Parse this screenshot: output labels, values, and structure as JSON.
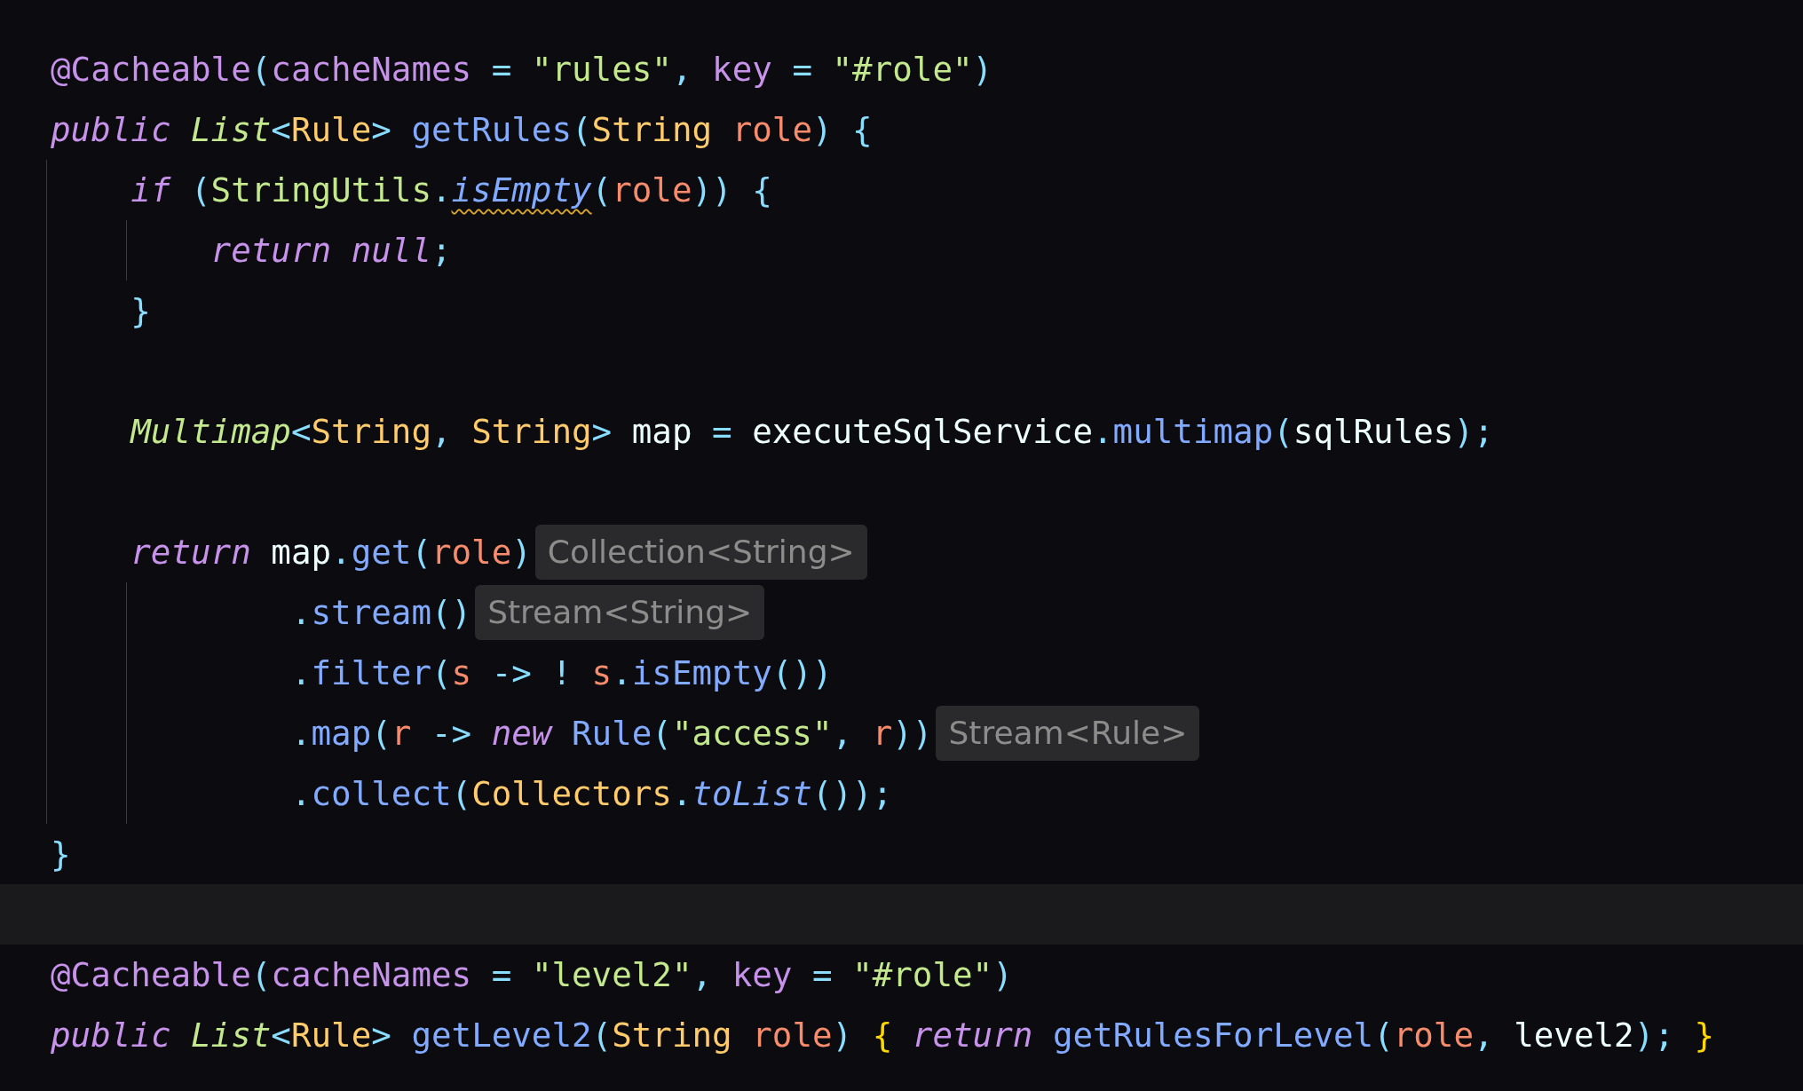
{
  "editor": {
    "lines": [
      {
        "current": false,
        "tokens": [
          {
            "text": "@Cacheable",
            "kind": "ann"
          },
          {
            "text": "(",
            "kind": "punc"
          },
          {
            "text": "cacheNames",
            "kind": "attr"
          },
          {
            "text": " = ",
            "kind": "op"
          },
          {
            "text": "\"rules\"",
            "kind": "str"
          },
          {
            "text": ", ",
            "kind": "op"
          },
          {
            "text": "key",
            "kind": "attr"
          },
          {
            "text": " = ",
            "kind": "op"
          },
          {
            "text": "\"#role\"",
            "kind": "str"
          },
          {
            "text": ")",
            "kind": "punc"
          }
        ]
      },
      {
        "current": false,
        "tokens": [
          {
            "text": "public ",
            "kind": "kw"
          },
          {
            "text": "List",
            "kind": "itype"
          },
          {
            "text": "<",
            "kind": "op"
          },
          {
            "text": "Rule",
            "kind": "type"
          },
          {
            "text": "> ",
            "kind": "op"
          },
          {
            "text": "getRules",
            "kind": "fn"
          },
          {
            "text": "(",
            "kind": "punc"
          },
          {
            "text": "String ",
            "kind": "type"
          },
          {
            "text": "role",
            "kind": "param"
          },
          {
            "text": ") {",
            "kind": "punc"
          }
        ],
        "kind": "block",
        "children": [
          {
            "current": false,
            "tokens": [
              {
                "text": "if ",
                "kind": "kw"
              },
              {
                "text": "(",
                "kind": "punc"
              },
              {
                "text": "StringUtils",
                "kind": "cls"
              },
              {
                "text": ".",
                "kind": "op"
              },
              {
                "text": "isEmpty",
                "kind": "warnfn"
              },
              {
                "text": "(",
                "kind": "punc"
              },
              {
                "text": "role",
                "kind": "param"
              },
              {
                "text": ")) {",
                "kind": "punc"
              }
            ],
            "kind": "block",
            "children": [
              {
                "current": false,
                "tokens": [
                  {
                    "text": "return null",
                    "kind": "kw"
                  },
                  {
                    "text": ";",
                    "kind": "op"
                  }
                ]
              }
            ]
          },
          {
            "current": false,
            "tokens": [
              {
                "text": "}",
                "kind": "punc"
              }
            ]
          },
          {
            "current": false
          },
          {
            "current": false,
            "tokens": [
              {
                "text": "Multimap",
                "kind": "itype"
              },
              {
                "text": "<",
                "kind": "op"
              },
              {
                "text": "String",
                "kind": "type"
              },
              {
                "text": ", ",
                "kind": "op"
              },
              {
                "text": "String",
                "kind": "type"
              },
              {
                "text": "> ",
                "kind": "op"
              },
              {
                "text": "map ",
                "kind": "var"
              },
              {
                "text": "= ",
                "kind": "op"
              },
              {
                "text": "executeSqlService",
                "kind": "var"
              },
              {
                "text": ".",
                "kind": "op"
              },
              {
                "text": "multimap",
                "kind": "fn"
              },
              {
                "text": "(",
                "kind": "punc"
              },
              {
                "text": "sqlRules",
                "kind": "var"
              },
              {
                "text": ");",
                "kind": "punc"
              }
            ]
          },
          {
            "current": false
          },
          {
            "current": false,
            "tokens": [
              {
                "text": "return ",
                "kind": "kw"
              },
              {
                "text": "map",
                "kind": "var"
              },
              {
                "text": ".",
                "kind": "op"
              },
              {
                "text": "get",
                "kind": "fn"
              },
              {
                "text": "(",
                "kind": "punc"
              },
              {
                "text": "role",
                "kind": "param"
              },
              {
                "text": ")",
                "kind": "punc"
              }
            ],
            "hint": "Collection<String>",
            "kind": "chain",
            "children": [
              {
                "current": false,
                "tokens": [
                  {
                    "text": ".",
                    "kind": "op"
                  },
                  {
                    "text": "stream",
                    "kind": "fn"
                  },
                  {
                    "text": "()",
                    "kind": "punc"
                  }
                ],
                "hint": "Stream<String>"
              },
              {
                "current": false,
                "tokens": [
                  {
                    "text": ".",
                    "kind": "op"
                  },
                  {
                    "text": "filter",
                    "kind": "fn"
                  },
                  {
                    "text": "(",
                    "kind": "punc"
                  },
                  {
                    "text": "s ",
                    "kind": "param"
                  },
                  {
                    "text": "-> ! ",
                    "kind": "op"
                  },
                  {
                    "text": "s",
                    "kind": "param"
                  },
                  {
                    "text": ".",
                    "kind": "op"
                  },
                  {
                    "text": "isEmpty",
                    "kind": "fn"
                  },
                  {
                    "text": "())",
                    "kind": "punc"
                  }
                ]
              },
              {
                "current": false,
                "tokens": [
                  {
                    "text": ".",
                    "kind": "op"
                  },
                  {
                    "text": "map",
                    "kind": "fn"
                  },
                  {
                    "text": "(",
                    "kind": "punc"
                  },
                  {
                    "text": "r ",
                    "kind": "param"
                  },
                  {
                    "text": "-> ",
                    "kind": "op"
                  },
                  {
                    "text": "new ",
                    "kind": "kw"
                  },
                  {
                    "text": "Rule",
                    "kind": "fn"
                  },
                  {
                    "text": "(",
                    "kind": "punc"
                  },
                  {
                    "text": "\"access\"",
                    "kind": "str"
                  },
                  {
                    "text": ", ",
                    "kind": "op"
                  },
                  {
                    "text": "r",
                    "kind": "param"
                  },
                  {
                    "text": "))",
                    "kind": "punc"
                  }
                ],
                "hint": "Stream<Rule>"
              },
              {
                "current": false,
                "tokens": [
                  {
                    "text": ".",
                    "kind": "op"
                  },
                  {
                    "text": "collect",
                    "kind": "fn"
                  },
                  {
                    "text": "(",
                    "kind": "punc"
                  },
                  {
                    "text": "Collectors",
                    "kind": "type"
                  },
                  {
                    "text": ".",
                    "kind": "op"
                  },
                  {
                    "text": "toList",
                    "kind": "ifn"
                  },
                  {
                    "text": "());",
                    "kind": "punc"
                  }
                ]
              }
            ]
          }
        ]
      },
      {
        "current": false,
        "tokens": [
          {
            "text": "}",
            "kind": "punc"
          }
        ]
      },
      {
        "current": true
      },
      {
        "current": false,
        "tokens": [
          {
            "text": "@Cacheable",
            "kind": "ann"
          },
          {
            "text": "(",
            "kind": "punc"
          },
          {
            "text": "cacheNames",
            "kind": "attr"
          },
          {
            "text": " = ",
            "kind": "op"
          },
          {
            "text": "\"level2\"",
            "kind": "str"
          },
          {
            "text": ", ",
            "kind": "op"
          },
          {
            "text": "key",
            "kind": "attr"
          },
          {
            "text": " = ",
            "kind": "op"
          },
          {
            "text": "\"#role\"",
            "kind": "str"
          },
          {
            "text": ")",
            "kind": "punc"
          }
        ]
      },
      {
        "current": false,
        "tokens": [
          {
            "text": "public ",
            "kind": "kw"
          },
          {
            "text": "List",
            "kind": "itype"
          },
          {
            "text": "<",
            "kind": "op"
          },
          {
            "text": "Rule",
            "kind": "type"
          },
          {
            "text": "> ",
            "kind": "op"
          },
          {
            "text": "getLevel2",
            "kind": "fn"
          },
          {
            "text": "(",
            "kind": "punc"
          },
          {
            "text": "String ",
            "kind": "type"
          },
          {
            "text": "role",
            "kind": "param"
          },
          {
            "text": ") ",
            "kind": "punc"
          },
          {
            "text": "{ ",
            "kind": "brace"
          },
          {
            "text": "return ",
            "kind": "kw"
          },
          {
            "text": "getRulesForLevel",
            "kind": "fn"
          },
          {
            "text": "(",
            "kind": "punc"
          },
          {
            "text": "role",
            "kind": "param"
          },
          {
            "text": ", ",
            "kind": "op"
          },
          {
            "text": "level2",
            "kind": "var"
          },
          {
            "text": "); ",
            "kind": "punc"
          },
          {
            "text": "}",
            "kind": "brace"
          }
        ]
      }
    ]
  }
}
